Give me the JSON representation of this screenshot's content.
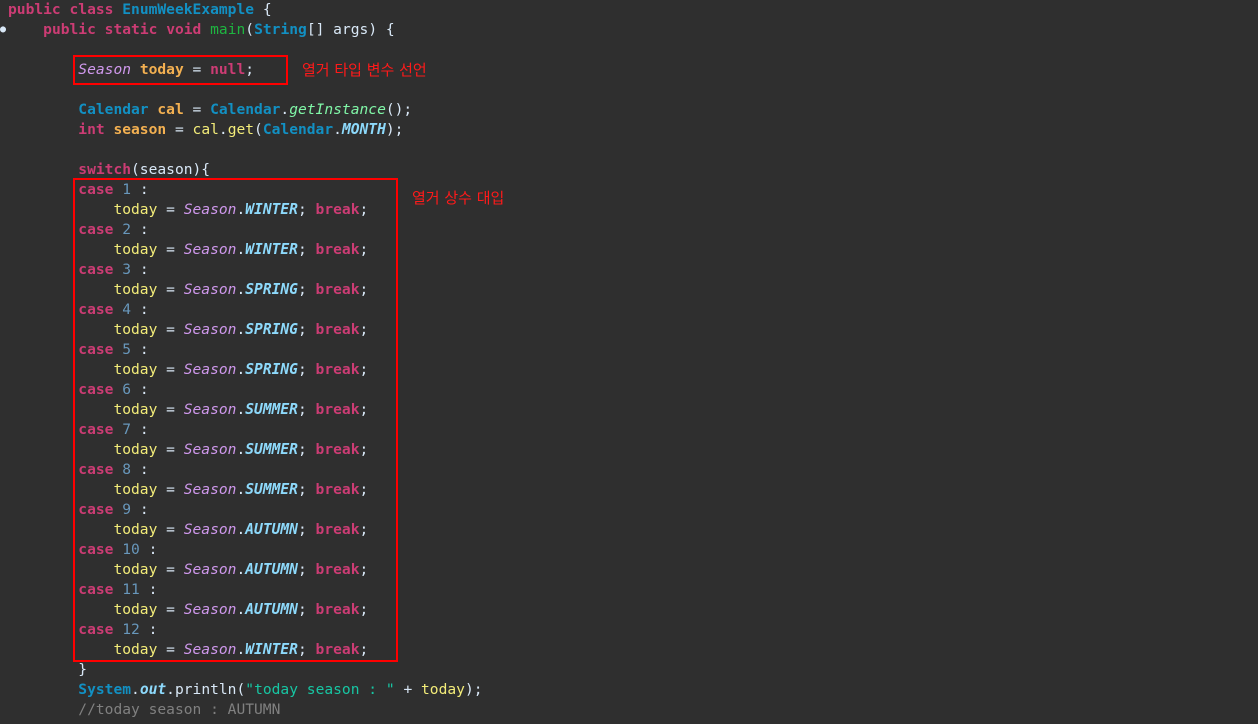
{
  "code": {
    "class_decl": {
      "kw_public": "public",
      "kw_class": "class",
      "class_name": "EnumWeekExample",
      "brace": " {"
    },
    "main_decl": {
      "kw_public": "public",
      "kw_static": "static",
      "kw_void": "void",
      "method": "main",
      "param_type": "String",
      "brackets": "[] ",
      "param": "args",
      "tail": ") {"
    },
    "season_decl": {
      "type": "Season",
      "var": "today",
      "eq": " = ",
      "null": "null",
      "semi": ";"
    },
    "calendar_decl": {
      "type": "Calendar",
      "var": "cal",
      "eq": " = ",
      "cls": "Calendar",
      "dot": ".",
      "method": "getInstance",
      "tail": "();"
    },
    "int_decl": {
      "type": "int",
      "var": "season",
      "eq": " = ",
      "obj": "cal",
      "dot": ".",
      "method": "get",
      "open": "(",
      "cls": "Calendar",
      "dot2": ".",
      "const": "MONTH",
      "tail": ");"
    },
    "switch_line": {
      "kw": "switch",
      "tail": "(season){"
    },
    "cases": [
      {
        "num": "1",
        "const": "WINTER"
      },
      {
        "num": "2",
        "const": "WINTER"
      },
      {
        "num": "3",
        "const": "SPRING"
      },
      {
        "num": "4",
        "const": "SPRING"
      },
      {
        "num": "5",
        "const": "SPRING"
      },
      {
        "num": "6",
        "const": "SUMMER"
      },
      {
        "num": "7",
        "const": "SUMMER"
      },
      {
        "num": "8",
        "const": "SUMMER"
      },
      {
        "num": "9",
        "const": "AUTUMN"
      },
      {
        "num": "10",
        "const": "AUTUMN"
      },
      {
        "num": "11",
        "const": "AUTUMN"
      },
      {
        "num": "12",
        "const": "WINTER"
      }
    ],
    "case_kw": "case",
    "case_colon": " :",
    "assign_var": "today",
    "assign_eq": " = ",
    "enum_type": "Season",
    "enum_dot": ".",
    "semi": "; ",
    "break_kw": "break",
    "break_semi": ";",
    "close_brace": "}",
    "println": {
      "cls": "System",
      "dot": ".",
      "field": "out",
      "dot2": ".",
      "method": "println",
      "open": "(",
      "str": "\"today season : \"",
      "plus": " + ",
      "var": "today",
      "tail": ");"
    },
    "comment": "//today season : AUTUMN"
  },
  "annotations": {
    "declare": "열거 타입 변수 선언",
    "assign": "열거 상수 대입"
  },
  "colors": {
    "background": "#2f2f2f",
    "highlight_box": "#ff0000",
    "annotation_text": "#ff1a1a"
  }
}
